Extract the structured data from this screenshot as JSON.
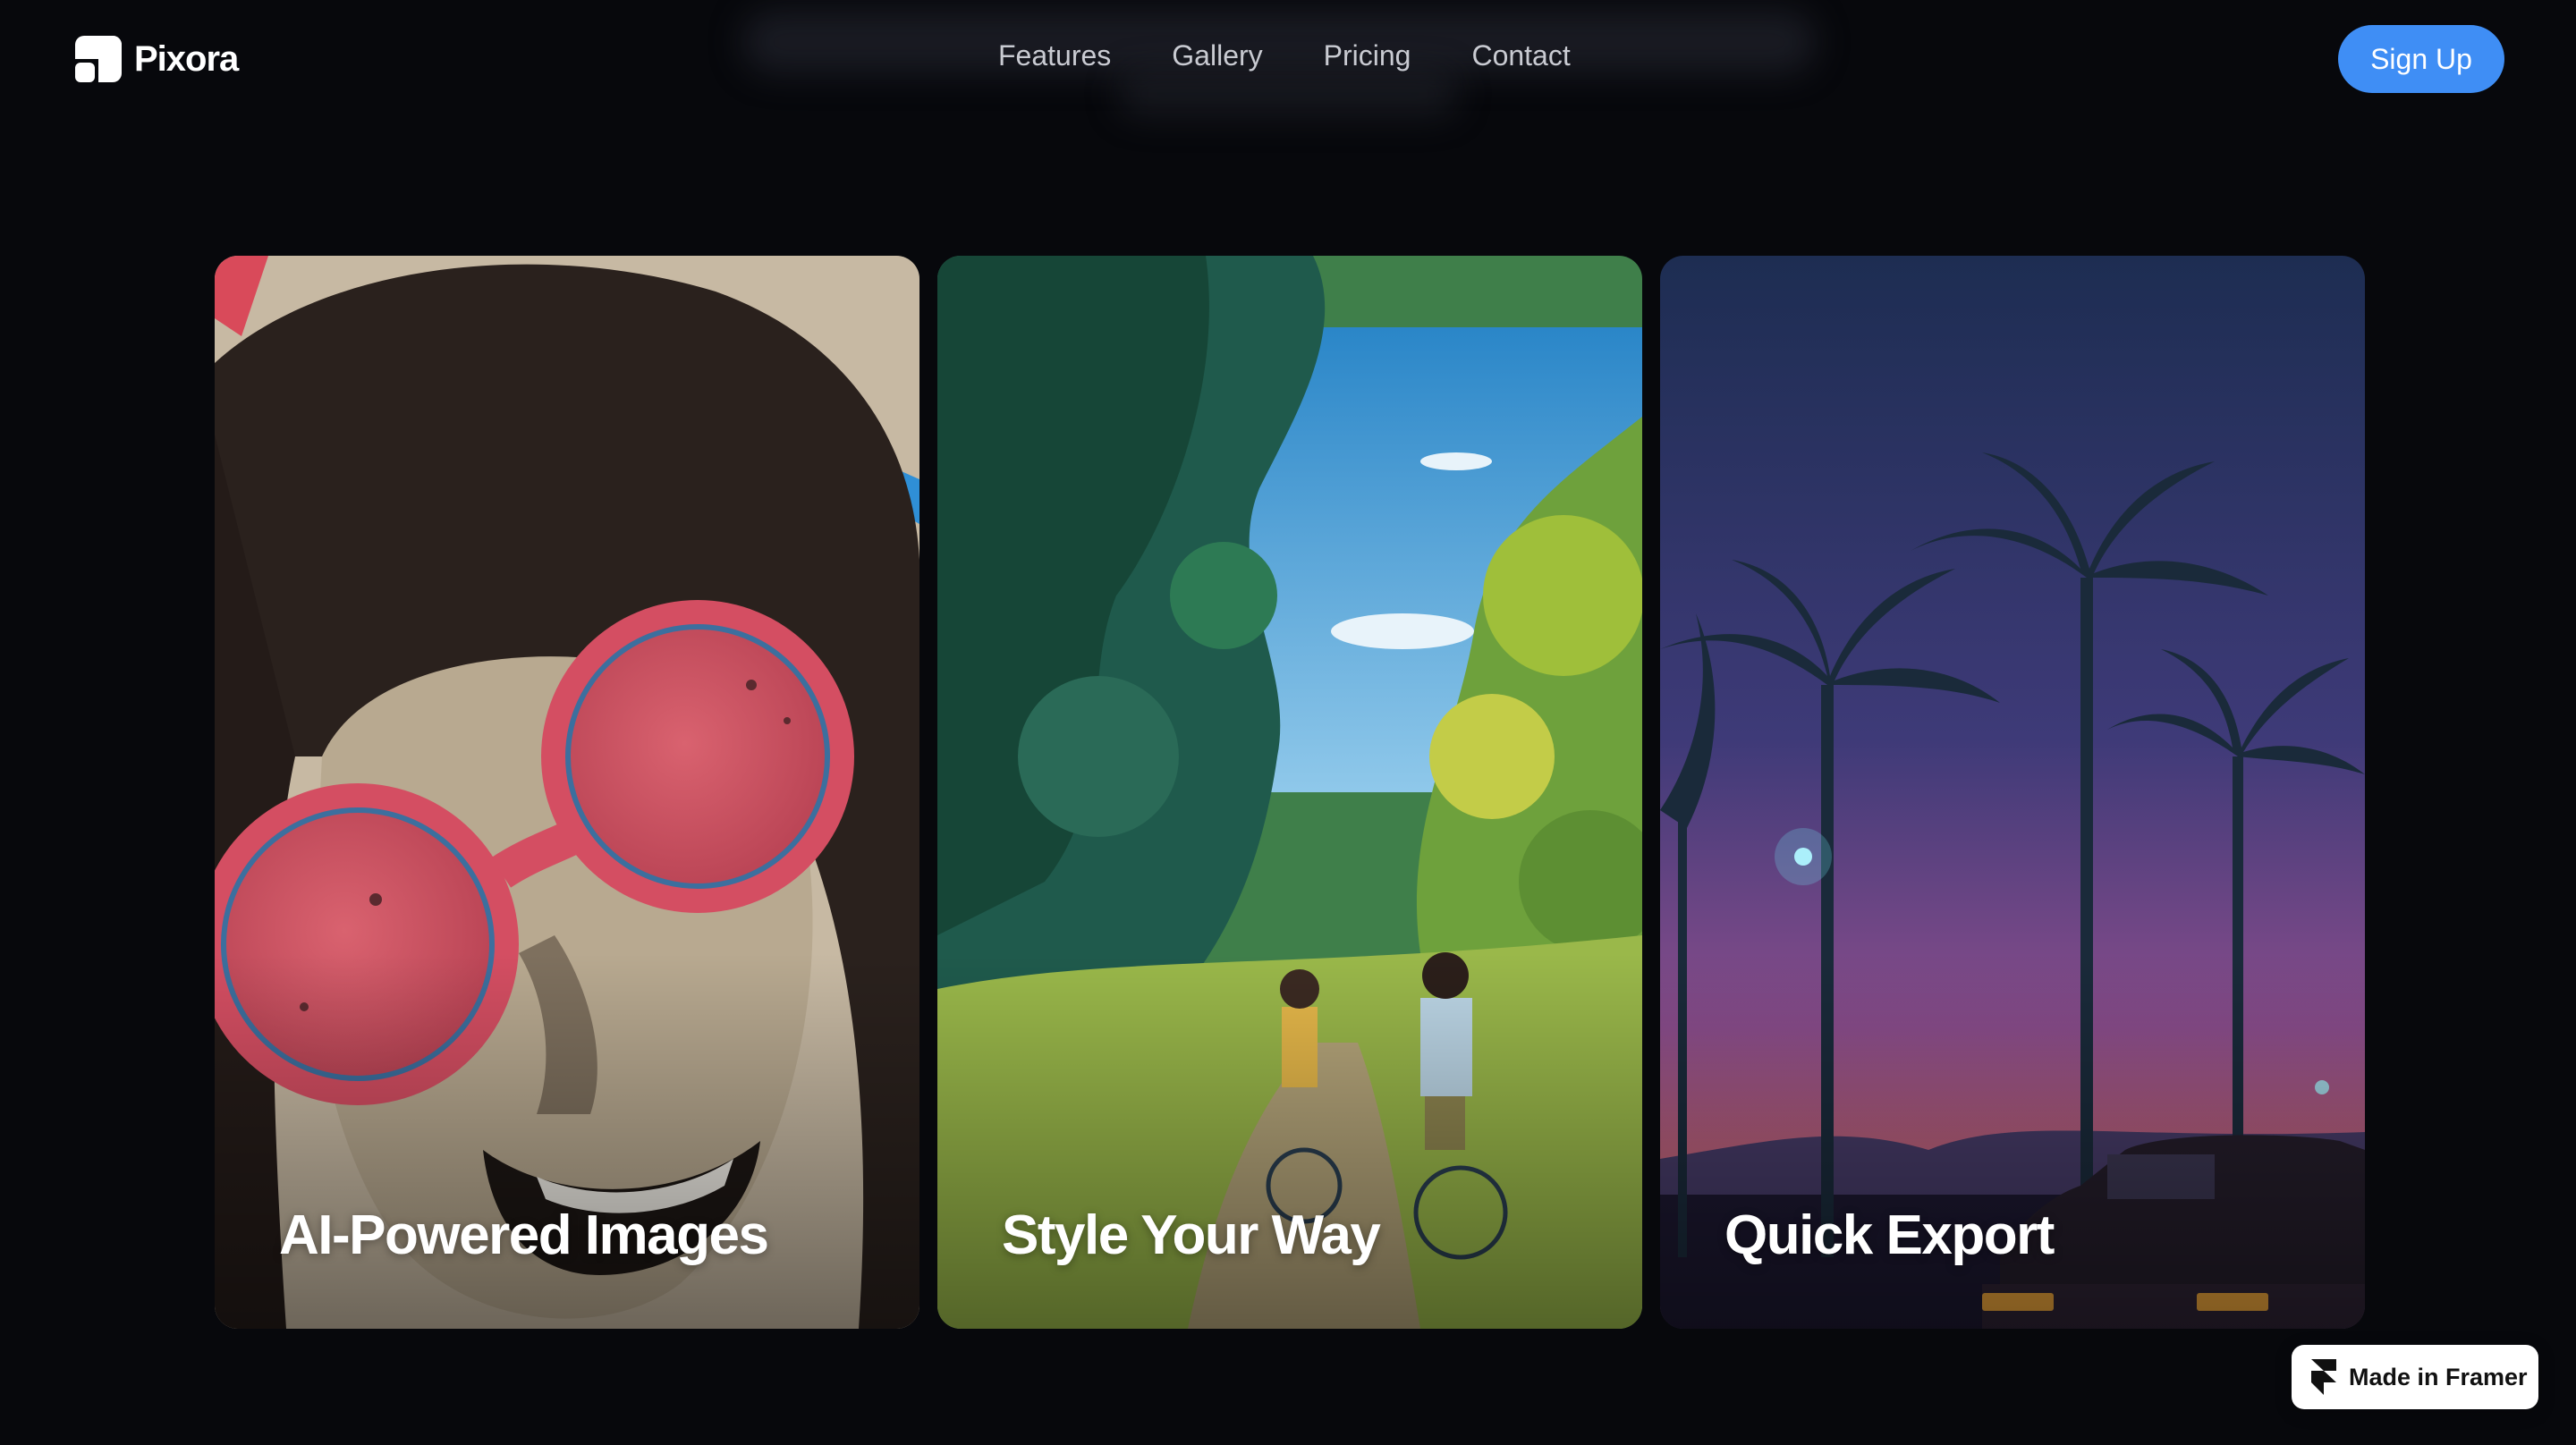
{
  "header": {
    "brand": "Pixora",
    "nav": [
      "Features",
      "Gallery",
      "Pricing",
      "Contact"
    ],
    "cta": "Sign Up"
  },
  "cards": [
    {
      "title": "AI-Powered Images"
    },
    {
      "title": "Style Your Way"
    },
    {
      "title": "Quick Export"
    }
  ],
  "badge": {
    "label": "Made in Framer"
  },
  "colors": {
    "background": "#07080c",
    "accent": "#3f8ef5"
  }
}
